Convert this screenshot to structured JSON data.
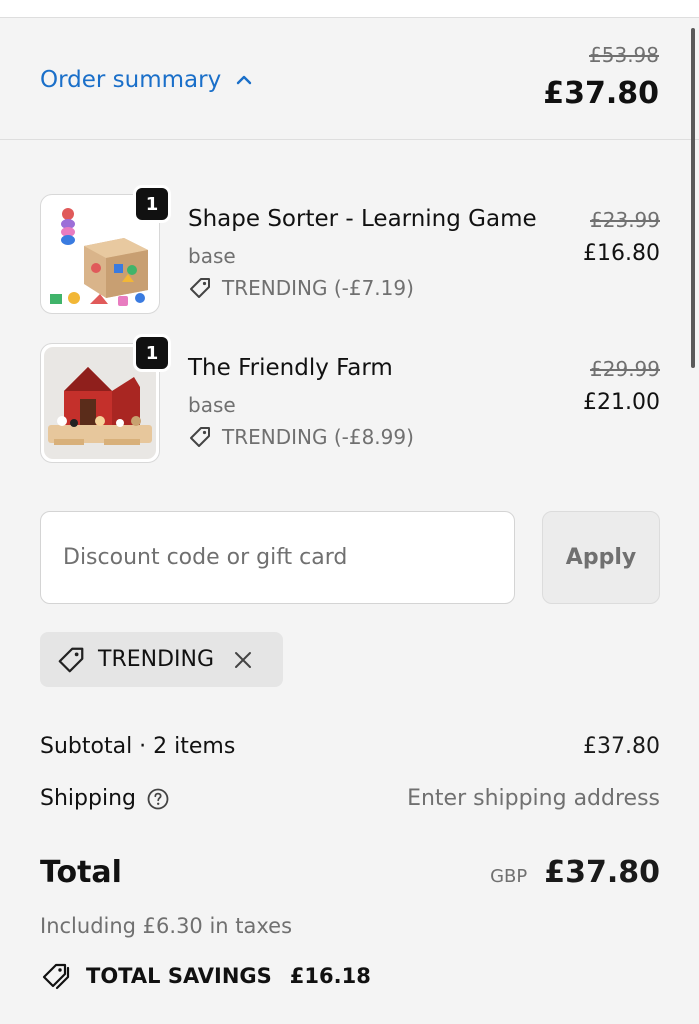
{
  "header": {
    "toggle_label": "Order summary",
    "original_total": "£53.98",
    "total": "£37.80"
  },
  "line_items": [
    {
      "quantity": "1",
      "title": "Shape Sorter - Learning Game",
      "variant": "base",
      "discount": "TRENDING (-£7.19)",
      "original_price": "£23.99",
      "price": "£16.80"
    },
    {
      "quantity": "1",
      "title": "The Friendly Farm",
      "variant": "base",
      "discount": "TRENDING (-£8.99)",
      "original_price": "£29.99",
      "price": "£21.00"
    }
  ],
  "discount": {
    "placeholder": "Discount code or gift card",
    "value": "",
    "apply_label": "Apply",
    "applied_code": "TRENDING"
  },
  "totals": {
    "subtotal_label": "Subtotal · 2 items",
    "subtotal_value": "£37.80",
    "shipping_label": "Shipping",
    "shipping_value": "Enter shipping address",
    "total_label": "Total",
    "currency": "GBP",
    "total_value": "£37.80",
    "taxes_note": "Including £6.30 in taxes",
    "savings_label": "TOTAL SAVINGS",
    "savings_value": "£16.18"
  },
  "icons": {
    "toggle": "chevron-up-icon",
    "discount_tag": "tag-icon",
    "remove": "close-icon",
    "help": "help-circle-icon",
    "savings": "tags-icon"
  },
  "colors": {
    "link": "#1a6fc9",
    "background": "#f4f4f4",
    "muted_text": "#707070"
  }
}
